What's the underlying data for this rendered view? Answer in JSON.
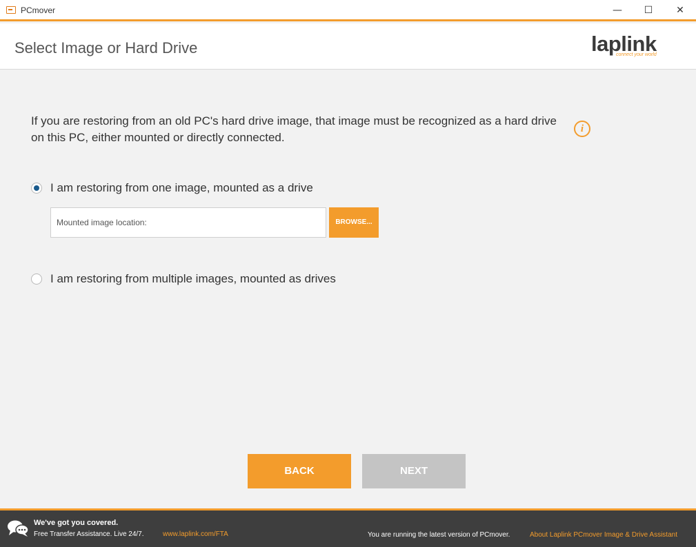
{
  "window": {
    "title": "PCmover",
    "minimize_glyph": "—",
    "maximize_glyph": "☐",
    "close_glyph": "✕"
  },
  "header": {
    "title": "Select Image or Hard Drive",
    "logo_text": "laplink",
    "logo_tagline": "connect your world"
  },
  "intro": {
    "text": "If you are restoring from an old PC's hard drive image, that image must be recognized as a hard drive on this PC, either mounted or directly connected.",
    "info_glyph": "i"
  },
  "options": [
    {
      "label": "I am restoring from one image, mounted as a drive",
      "selected": true
    },
    {
      "label": "I am restoring from multiple images, mounted as drives",
      "selected": false
    }
  ],
  "location": {
    "placeholder": "Mounted image location:",
    "value": "",
    "browse_label": "BROWSE..."
  },
  "nav": {
    "back_label": "BACK",
    "next_label": "NEXT",
    "next_enabled": false
  },
  "footer": {
    "headline": "We've got you covered.",
    "subtext": "Free Transfer Assistance. Live 24/7.",
    "link": "www.laplink.com/FTA",
    "status": "You are running the latest version of PCmover.",
    "about_link": "About Laplink PCmover Image & Drive Assistant"
  },
  "colors": {
    "accent": "#f39c2c",
    "disabled": "#c4c4c4",
    "radio_selected": "#1a5a8c",
    "footer_bg": "#3e3e3e"
  },
  "icons": {
    "app": "pcmover-app-icon",
    "info": "info-icon",
    "chat": "chat-bubbles-icon"
  }
}
